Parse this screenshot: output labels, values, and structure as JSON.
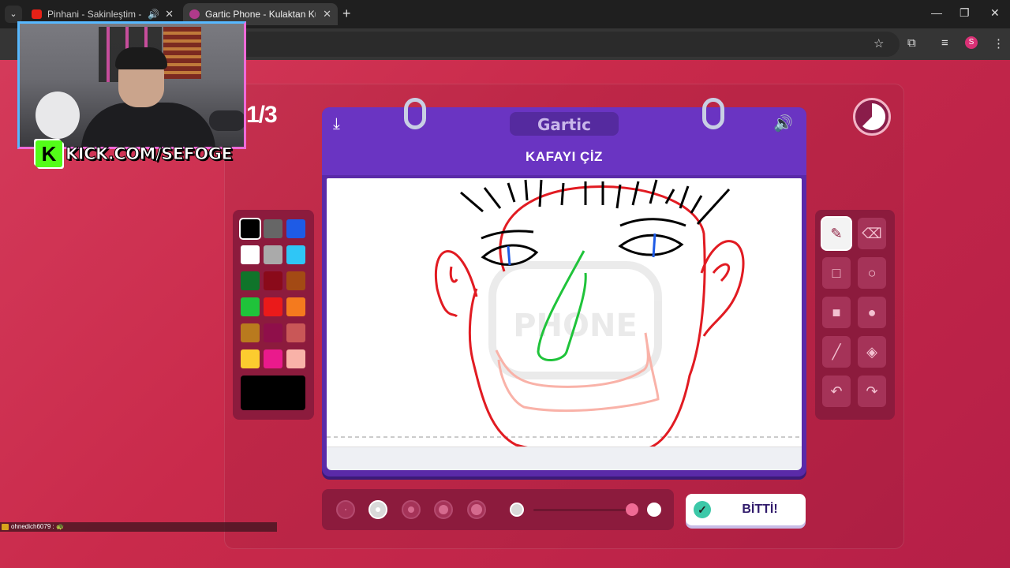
{
  "browser": {
    "tabs": [
      {
        "title": "Pinhani - Sakinleştim - You",
        "audio": true
      },
      {
        "title": "Gartic Phone - Kulaktan Kulağa",
        "active": true
      }
    ],
    "profile_initial": "S",
    "icons": [
      "tab-search-icon",
      "new-tab-icon",
      "minimize-icon",
      "restore-icon",
      "close-icon",
      "bookmark-star-icon",
      "extensions-icon",
      "media-control-icon",
      "menu-dots-icon"
    ]
  },
  "game": {
    "round": "1/3",
    "logo": "Gartic",
    "prompt": "KAFAYI ÇİZ",
    "done_label": "BİTTİ!",
    "palette": [
      "#000000",
      "#666666",
      "#1e5be6",
      "#ffffff",
      "#aaaaaa",
      "#2fc6f6",
      "#10742a",
      "#8a0a1a",
      "#a34a14",
      "#1fc33a",
      "#ea1a1a",
      "#f47a1e",
      "#b97a1e",
      "#8f0f4a",
      "#c95757",
      "#fccc2f",
      "#ea1a8c",
      "#f9b2a8"
    ],
    "selected_color": "#000000",
    "tools": [
      "pencil-icon",
      "eraser-icon",
      "rect-outline-icon",
      "circle-outline-icon",
      "rect-fill-icon",
      "circle-fill-icon",
      "line-icon",
      "fill-bucket-icon",
      "undo-icon",
      "redo-icon"
    ],
    "selected_tool": "pencil-icon",
    "brush_sizes": 5,
    "selected_brush_size": 2,
    "opacity_level": 1.0
  },
  "stream": {
    "overlay_text": "KICK.COM/SEFOGE",
    "chat_message": "ohnedich6079 : 🐢"
  }
}
